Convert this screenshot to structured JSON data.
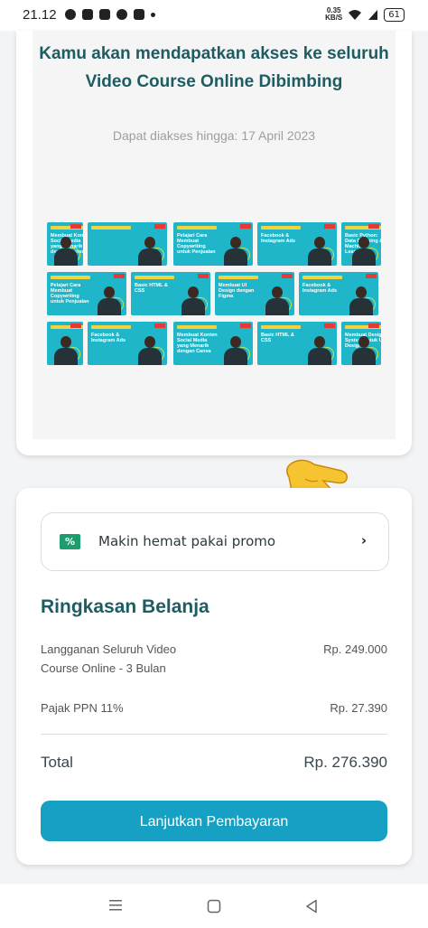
{
  "status_bar": {
    "time": "21.12",
    "speed_value": "0.35",
    "speed_unit": "KB/S",
    "battery": "61"
  },
  "course_card": {
    "headline": "Kamu akan mendapatkan akses ke seluruh Video Course Online Dibimbing",
    "access_until": "Dapat diakses hingga: 17 April 2023",
    "thumbnails": [
      {
        "title": "Membuat Konten Social Media yang Menarik dengan Canva"
      },
      {
        "title": ""
      },
      {
        "title": "Pelajari Cara Membuat Copywriting untuk Penjualan"
      },
      {
        "title": "Facebook & Instagram Ads"
      },
      {
        "title": "Basic Python: Data Cleaning & Machine Learning"
      },
      {
        "title": "Pelajari Cara Membuat Copywriting untuk Penjualan"
      },
      {
        "title": "Basic HTML & CSS"
      },
      {
        "title": "Membuat UI Design dengan Figma"
      },
      {
        "title": "Facebook & Instagram Ads"
      },
      {
        "title": ""
      },
      {
        "title": "Facebook & Instagram Ads"
      },
      {
        "title": "Membuat Konten Social Media yang Menarik dengan Canva"
      },
      {
        "title": "Basic HTML & CSS"
      },
      {
        "title": "Membuat Design System untuk UI Design"
      }
    ]
  },
  "promo": {
    "label": "Makin hemat pakai promo",
    "icon": "discount-ticket-icon",
    "chevron": "›"
  },
  "summary": {
    "title": "Ringkasan Belanja",
    "items": [
      {
        "label": "Langganan Seluruh Video Course Online - 3 Bulan",
        "value": "Rp. 249.000"
      },
      {
        "label": "Pajak PPN 11%",
        "value": "Rp. 27.390"
      }
    ],
    "total_label": "Total",
    "total_value": "Rp. 276.390"
  },
  "pay_button": {
    "label": "Lanjutkan Pembayaran",
    "color": "#16a0c4"
  },
  "colors": {
    "heading": "#1d5c63",
    "thumbnail_bg": "#1fb6c9"
  }
}
